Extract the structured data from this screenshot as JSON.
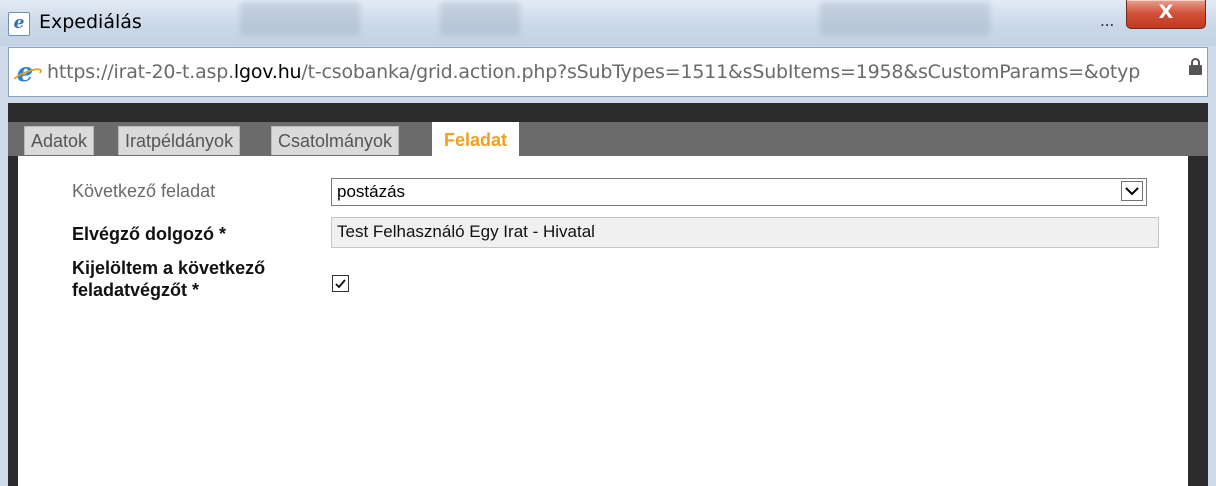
{
  "window": {
    "title": "Expediálás",
    "ellipsis": "...",
    "close_label": "X"
  },
  "address_bar": {
    "url_prefix": "https://irat-20-t.asp.",
    "url_domain": "lgov.hu",
    "url_rest": "/t-csobanka/grid.action.php?sSubTypes=1511&sSubItems=1958&sCustomParams=&otyp"
  },
  "tabs": [
    {
      "label": "Adatok",
      "active": false
    },
    {
      "label": "Iratpéldányok",
      "active": false
    },
    {
      "label": "Csatolmányok",
      "active": false
    },
    {
      "label": "Feladat",
      "active": true
    }
  ],
  "form": {
    "next_task_label": "Következő feladat",
    "next_task_value": "postázás",
    "worker_label": "Elvégző dolgozó *",
    "worker_value": "Test Felhasználó Egy Irat - Hivatal",
    "assigned_label_line1": "Kijelöltem a következő",
    "assigned_label_line2": "feladatvégzőt *",
    "assigned_checked": true
  },
  "colors": {
    "active_tab": "#f0a020",
    "close_button": "#c0381f",
    "frame": "#2b2b2b"
  }
}
